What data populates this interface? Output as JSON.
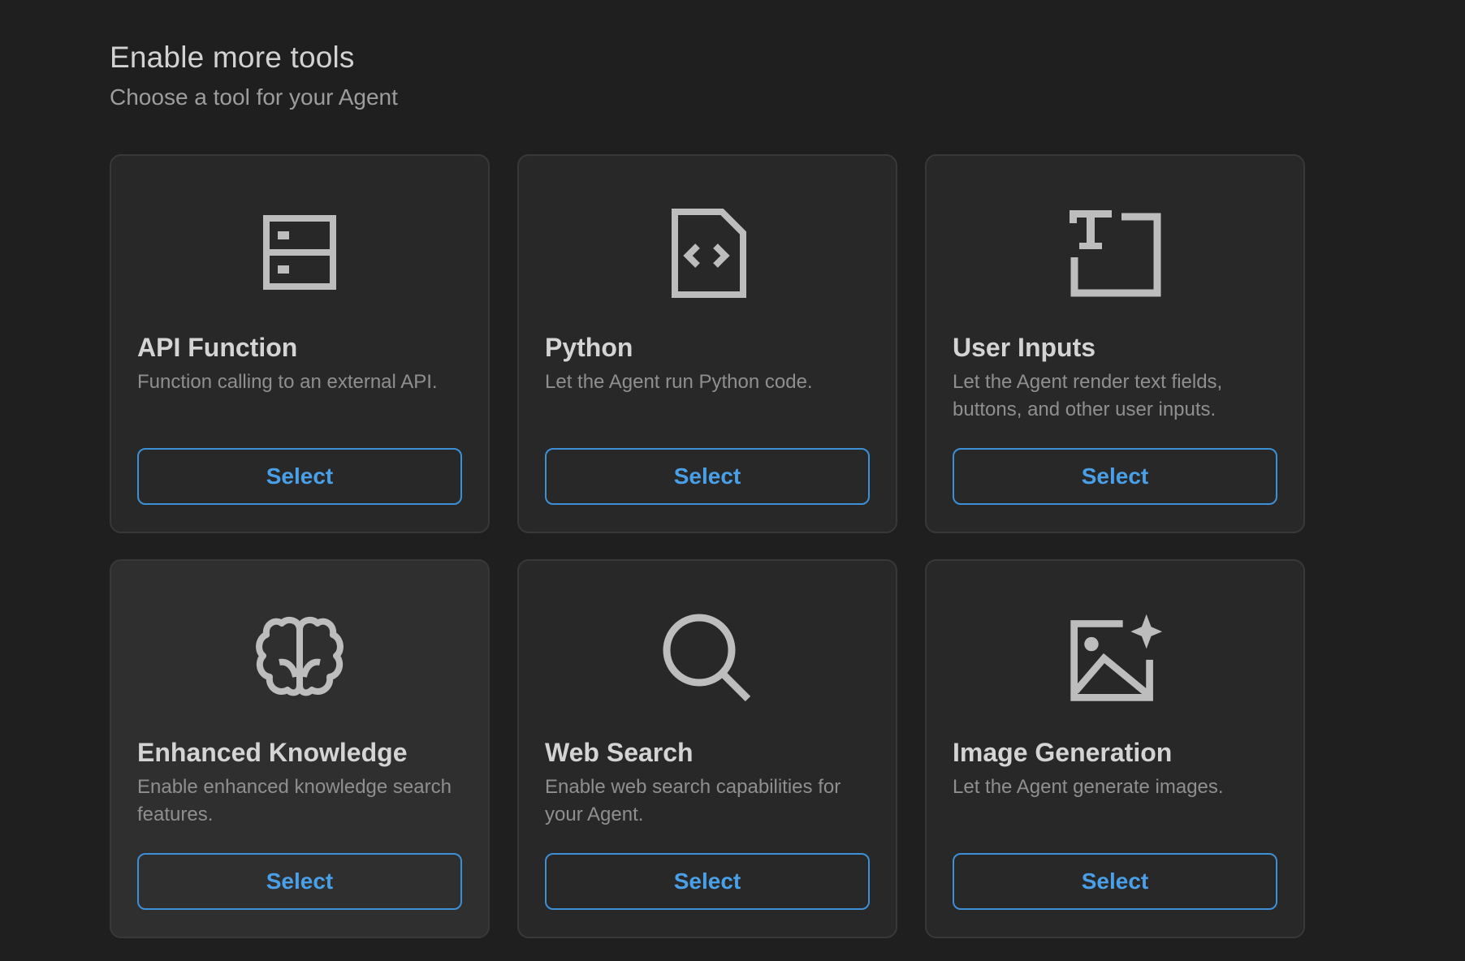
{
  "header": {
    "title": "Enable more tools",
    "subtitle": "Choose a tool for your Agent"
  },
  "colors": {
    "background": "#1f1f1f",
    "card": "#282828",
    "card_hover": "#2f2f2f",
    "card_border": "#383838",
    "accent": "#4aa0e8",
    "icon": "#bdbdbd"
  },
  "tools": [
    {
      "icon": "api-function-icon",
      "title": "API Function",
      "description": "Function calling to an external API.",
      "button": "Select"
    },
    {
      "icon": "python-code-file-icon",
      "title": "Python",
      "description": "Let the Agent run Python code.",
      "button": "Select"
    },
    {
      "icon": "user-inputs-icon",
      "title": "User Inputs",
      "description": "Let the Agent render text fields, buttons, and other user inputs.",
      "button": "Select"
    },
    {
      "icon": "brain-icon",
      "title": "Enhanced Knowledge",
      "description": "Enable enhanced knowledge search features.",
      "button": "Select",
      "hovered": true
    },
    {
      "icon": "search-icon",
      "title": "Web Search",
      "description": "Enable web search capabilities for your Agent.",
      "button": "Select"
    },
    {
      "icon": "image-generation-icon",
      "title": "Image Generation",
      "description": "Let the Agent generate images.",
      "button": "Select"
    }
  ]
}
